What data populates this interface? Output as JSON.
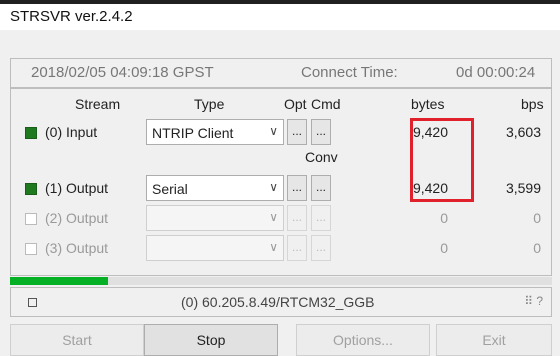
{
  "window": {
    "title": "STRSVR ver.2.4.2"
  },
  "status": {
    "datetime": "2018/02/05 04:09:18 GPST",
    "connect_time_label": "Connect Time:",
    "connect_time_value": "0d 00:00:24"
  },
  "headers": {
    "stream": "Stream",
    "type": "Type",
    "opt": "Opt",
    "cmd": "Cmd",
    "conv": "Conv",
    "bytes": "bytes",
    "bps": "bps"
  },
  "streams": [
    {
      "label": "(0) Input",
      "checked": true,
      "enabled": true,
      "type": "NTRIP Client",
      "bytes": "9,420",
      "bps": "3,603",
      "opt_label": "...",
      "cmd_label": "..."
    },
    {
      "label": "(1) Output",
      "checked": true,
      "enabled": true,
      "type": "Serial",
      "bytes": "9,420",
      "bps": "3,599",
      "opt_label": "...",
      "cmd_label": "..."
    },
    {
      "label": "(2) Output",
      "checked": false,
      "enabled": false,
      "type": "",
      "bytes": "0",
      "bps": "0",
      "opt_label": "...",
      "cmd_label": "..."
    },
    {
      "label": "(3) Output",
      "checked": false,
      "enabled": false,
      "type": "",
      "bytes": "0",
      "bps": "0",
      "opt_label": "...",
      "cmd_label": "..."
    }
  ],
  "progress": {
    "value_fraction": 0.18,
    "color": "#06b025"
  },
  "info": {
    "stream_text": "(0) 60.205.8.49/RTCM32_GGB",
    "grip_glyph": "?"
  },
  "buttons": {
    "start": "Start",
    "stop": "Stop",
    "options": "Options...",
    "exit": "Exit"
  },
  "accent": {
    "highlight_color": "#e0202a",
    "checkbox_on": "#1f7a1f"
  }
}
